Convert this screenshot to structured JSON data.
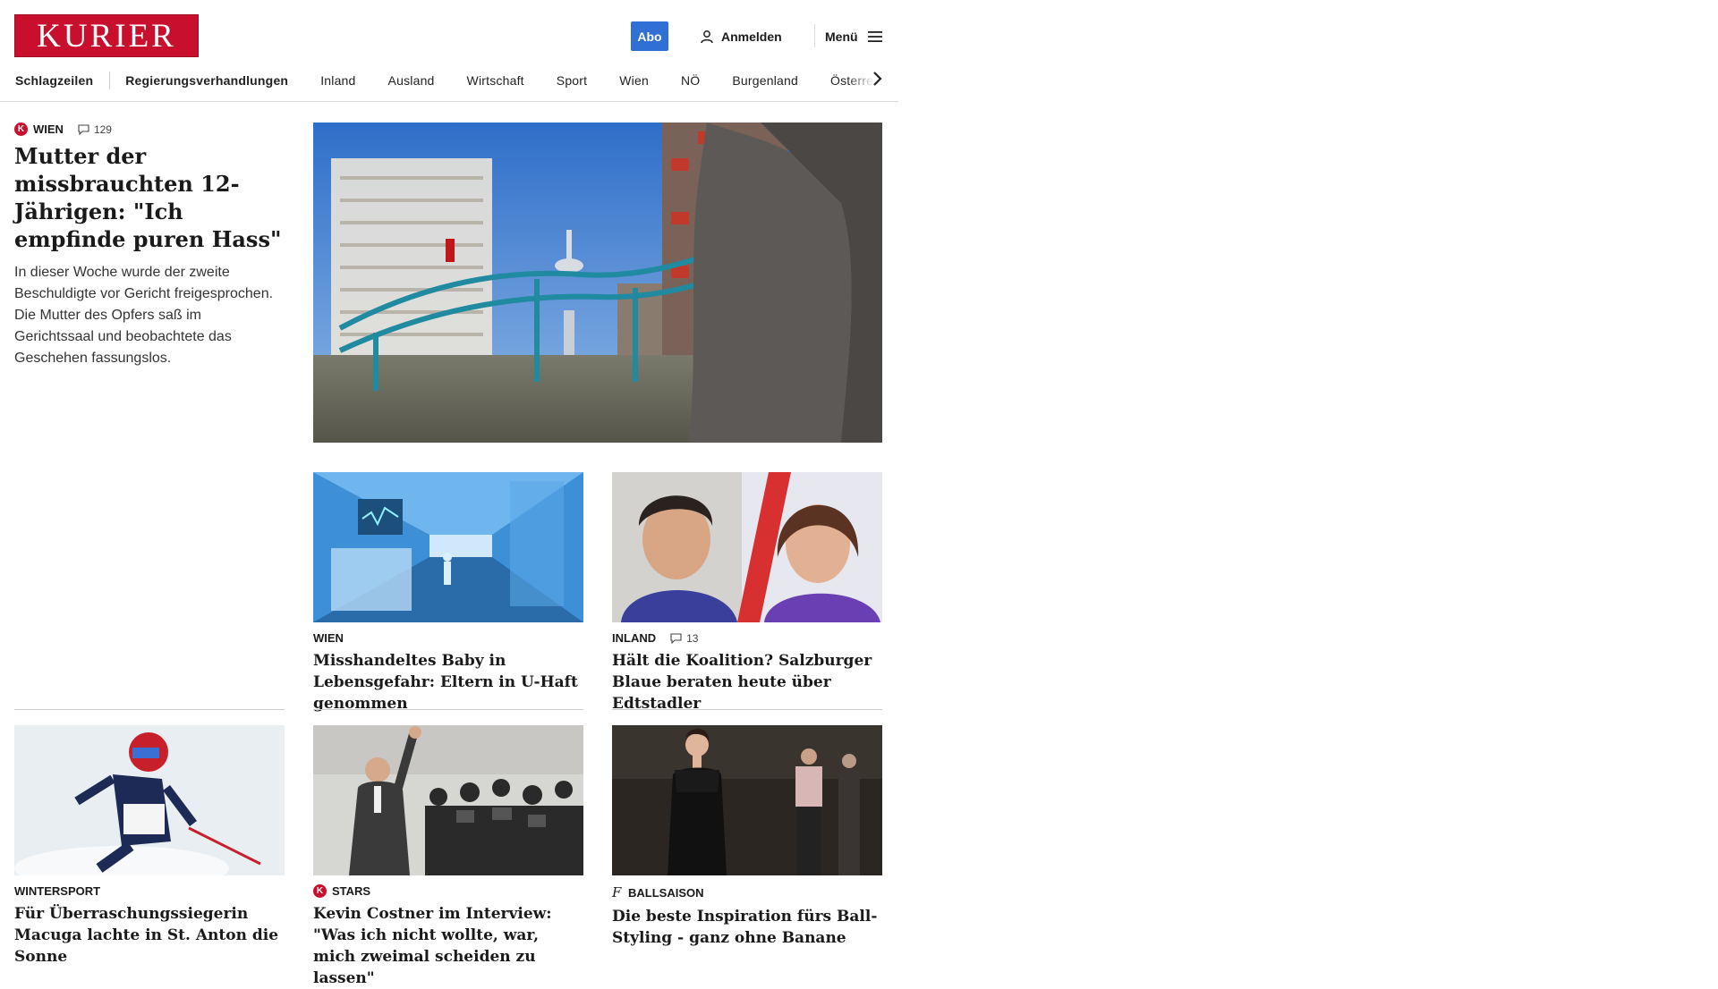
{
  "header": {
    "logo": "KURIER",
    "abo": "Abo",
    "login": "Anmelden",
    "menu": "Menü"
  },
  "nav": {
    "items": [
      "Schlagzeilen",
      "Regierungsverhandlungen",
      "Inland",
      "Ausland",
      "Wirtschaft",
      "Sport",
      "Wien",
      "NÖ",
      "Burgenland",
      "Österreich"
    ]
  },
  "lead": {
    "badge": "K",
    "kicker": "WIEN",
    "comments": "129",
    "title": "Mutter der missbrauch­ten 12-Jährigen: \"Ich empfinde puren Hass\"",
    "text": "In dieser Woche wurde der zweite Beschuldigte vor Gericht freigesprochen. Die Mutter des Opfers saß im Gerichtssaal und beobachtete das Geschehen fassungslos."
  },
  "cards": [
    {
      "kicker": "WIEN",
      "title": "Misshandeltes Baby in Lebensge­fahr: Eltern in U-Haft genommen"
    },
    {
      "kicker": "INLAND",
      "comments": "13",
      "title": "Hält die Koalition? Salzburger Blaue beraten heute über Edtstadler"
    },
    {
      "kicker": "WINTERSPORT",
      "title": "Für Überraschungssiegerin Ma­cuga lachte in St. Anton die Sonne"
    },
    {
      "badge": "K",
      "kicker": "STARS",
      "title": "Kevin Costner im Interview: \"Was ich nicht wollte, war, mich zwei­mal scheiden zu lassen\""
    },
    {
      "kicker": "BALLSAISON",
      "title": "Die beste Inspiration fürs Ball-Sty­ling - ganz ohne Banane"
    }
  ],
  "colors": {
    "brand": "#c8102e",
    "abo": "#2f6fd6"
  },
  "icons": {
    "login": "user-icon",
    "menu": "hamburger-icon",
    "comments": "comment-icon",
    "nav": "chevron-right-icon",
    "ballsaison": "f-script-icon"
  }
}
